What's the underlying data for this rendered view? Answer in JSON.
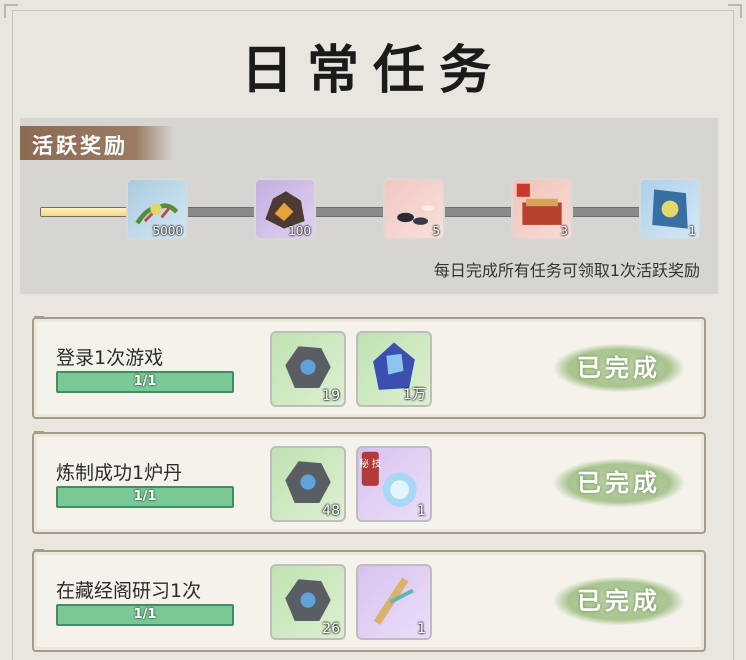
{
  "title": "日常任务",
  "activity_reward": {
    "tab_label": "活跃奖励",
    "progress": 0.15,
    "items": [
      {
        "icon": "grass-herb-icon",
        "qty": "5000"
      },
      {
        "icon": "dark-ore-icon",
        "qty": "100"
      },
      {
        "icon": "stones-icon",
        "qty": "5"
      },
      {
        "icon": "treasure-chest-icon",
        "qty": "3"
      },
      {
        "icon": "skill-book-icon",
        "qty": "1"
      }
    ],
    "note": "每日完成所有任务可领取1次活跃奖励"
  },
  "tasks": [
    {
      "name": "登录1次游戏",
      "progress_text": "1/1",
      "rewards": [
        {
          "icon": "stone-token-icon",
          "qty": "19",
          "bg": "green"
        },
        {
          "icon": "blue-crystal-icon",
          "qty": "1万",
          "bg": "green"
        }
      ],
      "status": "已完成"
    },
    {
      "name": "炼制成功1炉丹",
      "progress_text": "1/1",
      "rewards": [
        {
          "icon": "stone-token-icon",
          "qty": "48",
          "bg": "green"
        },
        {
          "icon": "spirit-orb-icon",
          "qty": "1",
          "bg": "purple",
          "tag": "秘 技"
        }
      ],
      "status": "已完成"
    },
    {
      "name": "在藏经阁研习1次",
      "progress_text": "1/1",
      "rewards": [
        {
          "icon": "stone-token-icon",
          "qty": "26",
          "bg": "green"
        },
        {
          "icon": "scroll-icon",
          "qty": "1",
          "bg": "purple"
        }
      ],
      "status": "已完成"
    }
  ]
}
